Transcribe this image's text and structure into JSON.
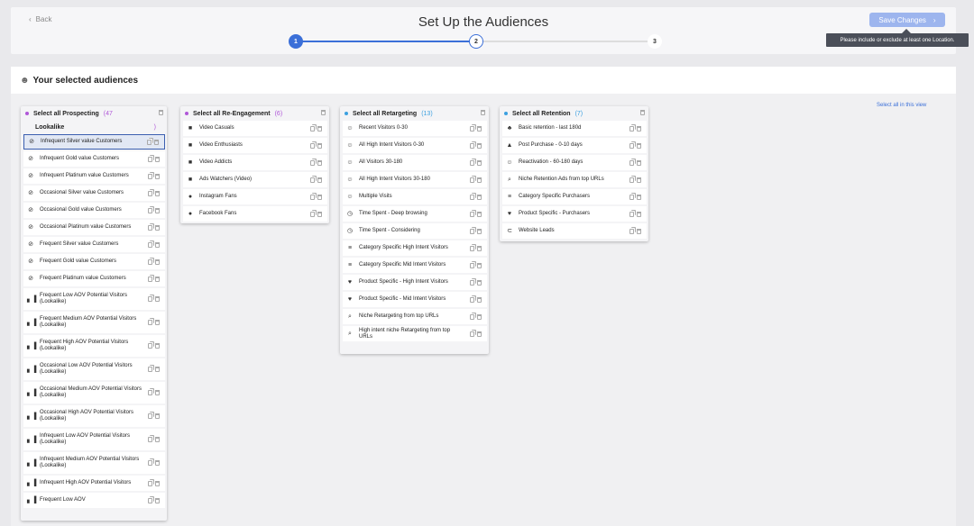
{
  "header": {
    "back_label": "Back",
    "title": "Set Up the Audiences",
    "steps": [
      "1",
      "2",
      "3"
    ],
    "save_label": "Save Changes",
    "tooltip": "Please include or exclude at least one Location."
  },
  "main": {
    "heading": "Your selected audiences",
    "select_all_view": "Select all in this view"
  },
  "colors": {
    "accent": "#3b6fd8",
    "purple": "#b057d8",
    "blue": "#3ba0e0"
  },
  "columns": [
    {
      "title": "Select all Prospecting",
      "count": "(47",
      "paren": ")",
      "sublabel": "Lookalike",
      "items": [
        {
          "text": "Infrequent Silver value Customers",
          "icon": "target-icon",
          "selected": true
        },
        {
          "text": "Infrequent Gold value Customers",
          "icon": "target-icon"
        },
        {
          "text": "Infrequent Platinum value Customers",
          "icon": "target-icon"
        },
        {
          "text": "Occasional Silver value Customers",
          "icon": "target-icon"
        },
        {
          "text": "Occasional Gold value Customers",
          "icon": "target-icon"
        },
        {
          "text": "Occasional Platinum value Customers",
          "icon": "target-icon"
        },
        {
          "text": "Frequent Silver value Customers",
          "icon": "target-icon"
        },
        {
          "text": "Frequent Gold value Customers",
          "icon": "target-icon"
        },
        {
          "text": "Frequent Platinum value Customers",
          "icon": "target-icon"
        },
        {
          "text": "Frequent Low AOV Potential Visitors (Lookalike)",
          "icon": "bar-chart-icon"
        },
        {
          "text": "Frequent Medium AOV Potential Visitors (Lookalike)",
          "icon": "bar-chart-icon"
        },
        {
          "text": "Frequent High AOV Potential Visitors (Lookalike)",
          "icon": "bar-chart-icon"
        },
        {
          "text": "Occasional Low AOV Potential Visitors (Lookalike)",
          "icon": "bar-chart-icon"
        },
        {
          "text": "Occasional Medium AOV Potential Visitors (Lookalike)",
          "icon": "bar-chart-icon"
        },
        {
          "text": "Occasional High AOV Potential Visitors (Lookalike)",
          "icon": "bar-chart-icon"
        },
        {
          "text": "Infrequent Low AOV Potential Visitors (Lookalike)",
          "icon": "bar-chart-icon"
        },
        {
          "text": "Infrequent Medium AOV Potential Visitors (Lookalike)",
          "icon": "bar-chart-icon"
        },
        {
          "text": "Infrequent High AOV Potential Visitors",
          "icon": "bar-chart-icon"
        },
        {
          "text": "Frequent Low AOV",
          "icon": "bar-chart-icon"
        }
      ]
    },
    {
      "title": "Select all Re-Engagement",
      "count": "(6)",
      "paren": "",
      "sublabel": "",
      "items": [
        {
          "text": "Video Casuals",
          "icon": "video-camera-icon"
        },
        {
          "text": "Video Enthusiasts",
          "icon": "video-camera-icon"
        },
        {
          "text": "Video Addicts",
          "icon": "video-camera-icon"
        },
        {
          "text": "Ads Watchers (Video)",
          "icon": "video-camera-icon"
        },
        {
          "text": "Instagram Fans",
          "icon": "chat-bubbles-icon"
        },
        {
          "text": "Facebook Fans",
          "icon": "chat-bubbles-icon"
        }
      ]
    },
    {
      "title": "Select all Retargeting",
      "count": "(13)",
      "paren": "",
      "sublabel": "",
      "items": [
        {
          "text": "Recent Visitors 0-30",
          "icon": "visitor-icon"
        },
        {
          "text": "All High Intent Visitors 0-30",
          "icon": "visitor-icon"
        },
        {
          "text": "All Visitors 30-180",
          "icon": "visitor-icon"
        },
        {
          "text": "All High Intent Visitors 30-180",
          "icon": "visitor-icon"
        },
        {
          "text": "Multiple Visits",
          "icon": "visitor-icon"
        },
        {
          "text": "Time Spent - Deep browsing",
          "icon": "clock-icon"
        },
        {
          "text": "Time Spent - Considering",
          "icon": "clock-icon"
        },
        {
          "text": "Category Specific High Intent Visitors",
          "icon": "list-icon"
        },
        {
          "text": "Category Specific Mid Intent Visitors",
          "icon": "list-icon"
        },
        {
          "text": "Product Specific - High Intent Visitors",
          "icon": "product-icon"
        },
        {
          "text": "Product Specific - Mid Intent Visitors",
          "icon": "product-icon"
        },
        {
          "text": "Niche Retargeting from top URLs",
          "icon": "search-icon"
        },
        {
          "text": "High intent niche Retargeting from top URLs",
          "icon": "search-icon"
        }
      ]
    },
    {
      "title": "Select all Retention",
      "count": "(7)",
      "paren": "",
      "sublabel": "",
      "items": [
        {
          "text": "Basic retention - last 180d",
          "icon": "users-icon"
        },
        {
          "text": "Post Purchase - 0-10 days",
          "icon": "shop-icon"
        },
        {
          "text": "Reactivation - 60-180 days",
          "icon": "visitor-icon"
        },
        {
          "text": "Niche Retention Ads from top URLs",
          "icon": "search-icon"
        },
        {
          "text": "Category Specific Purchasers",
          "icon": "list-icon"
        },
        {
          "text": "Product Specific - Purchasers",
          "icon": "product-icon"
        },
        {
          "text": "Website Leads",
          "icon": "magnet-icon"
        }
      ]
    }
  ]
}
